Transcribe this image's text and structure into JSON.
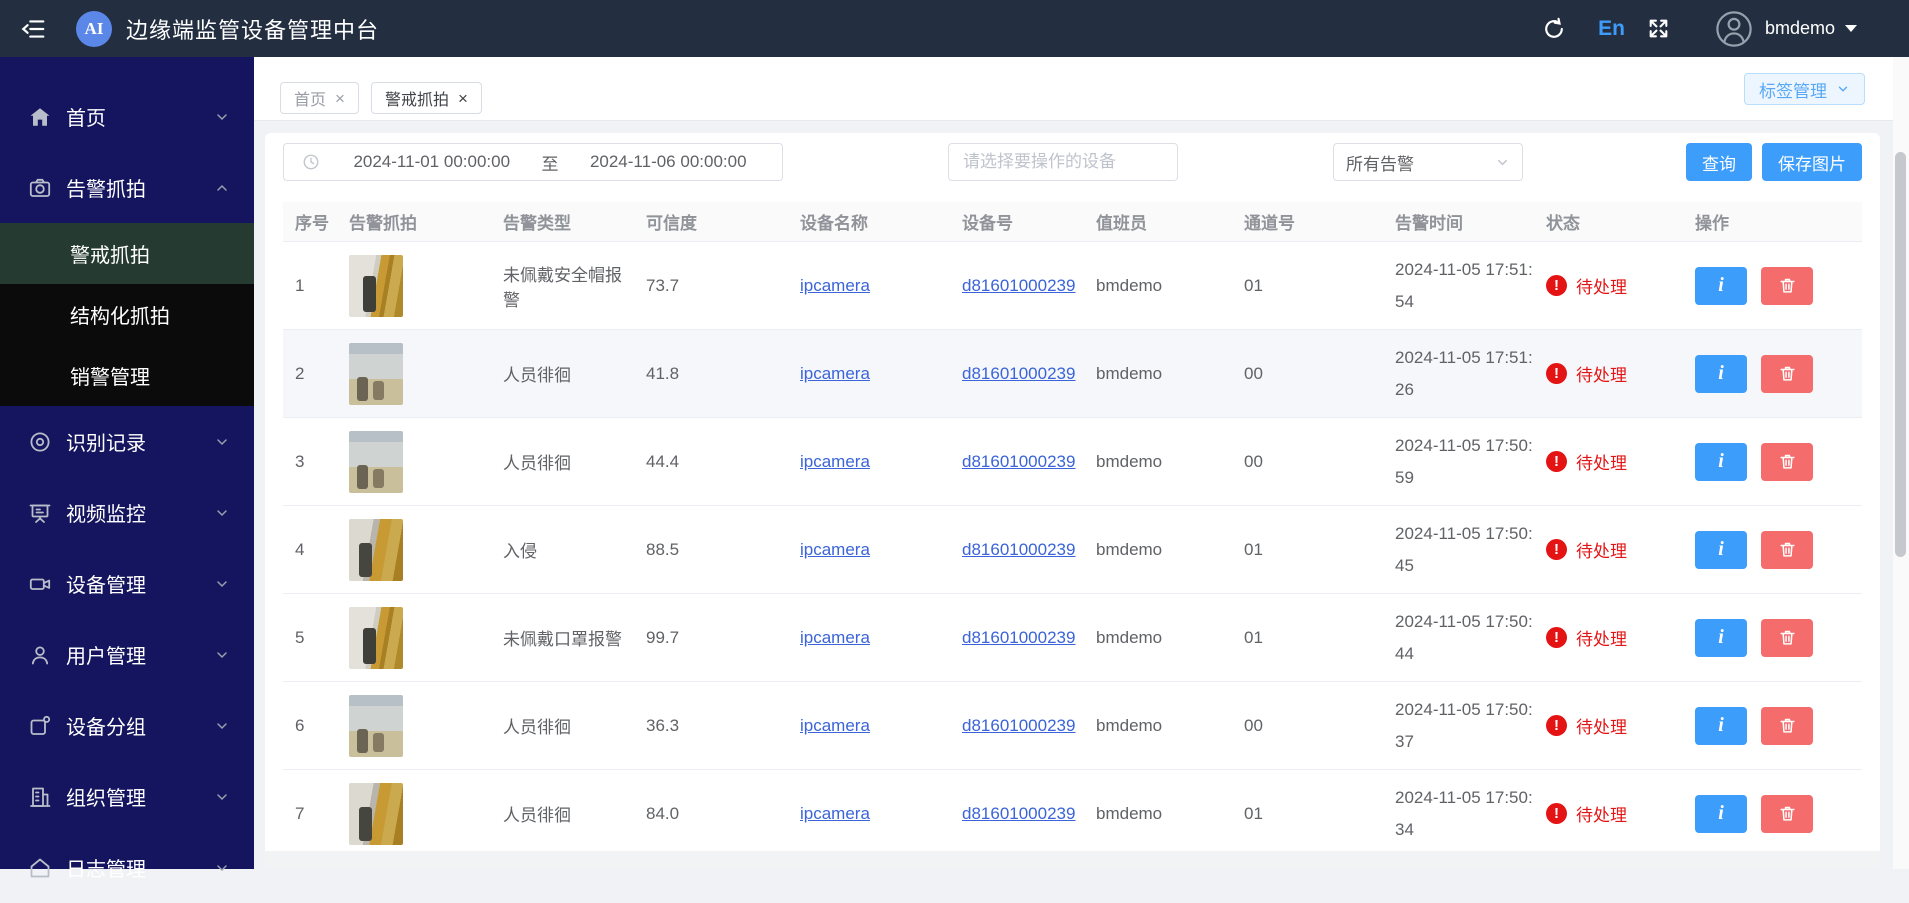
{
  "navbar": {
    "title": "边缘端监管设备管理中台",
    "logo": "AI",
    "language": "En",
    "username": "bmdemo"
  },
  "sidebar": {
    "menu": [
      {
        "label": "首页",
        "icon": "home-icon"
      },
      {
        "label": "告警抓拍",
        "icon": "camera-icon",
        "children": [
          {
            "label": "警戒抓拍",
            "active": true
          },
          {
            "label": "结构化抓拍",
            "active": false
          },
          {
            "label": "销警管理",
            "active": false
          }
        ]
      },
      {
        "label": "识别记录",
        "icon": "eye-icon"
      },
      {
        "label": "视频监控",
        "icon": "monitor-icon"
      },
      {
        "label": "设备管理",
        "icon": "video-camera-icon"
      },
      {
        "label": "用户管理",
        "icon": "user-icon"
      },
      {
        "label": "设备分组",
        "icon": "device-group-icon"
      },
      {
        "label": "组织管理",
        "icon": "organization-icon"
      },
      {
        "label": "日志管理",
        "icon": "log-icon"
      }
    ]
  },
  "tabs": [
    {
      "label": "首页",
      "close": "×",
      "active": false
    },
    {
      "label": "警戒抓拍",
      "close": "×",
      "active": true
    }
  ],
  "tag_manage": {
    "label": "标签管理"
  },
  "filters": {
    "date_start": "2024-11-01 00:00:00",
    "date_separator": "至",
    "date_end": "2024-11-06 00:00:00",
    "device_placeholder": "请选择要操作的设备",
    "alarm_type_selected": "所有告警",
    "query_button": "查询",
    "save_image_button": "保存图片"
  },
  "table": {
    "columns": [
      "序号",
      "告警抓拍",
      "告警类型",
      "可信度",
      "设备名称",
      "设备号",
      "值班员",
      "通道号",
      "告警时间",
      "状态",
      "操作"
    ],
    "rows": [
      {
        "index": "1",
        "type": "未佩戴安全帽报警",
        "confidence": "73.7",
        "device_name": "ipcamera",
        "device_id": "d81601000239",
        "operator": "bmdemo",
        "channel": "01",
        "time_line1": "2024-11-05 17:51:",
        "time_line2": "54",
        "status": "待处理",
        "state": "",
        "thumb": "thumb-a"
      },
      {
        "index": "2",
        "type": "人员徘徊",
        "confidence": "41.8",
        "device_name": "ipcamera",
        "device_id": "d81601000239",
        "operator": "bmdemo",
        "channel": "00",
        "time_line1": "2024-11-05 17:51:",
        "time_line2": "26",
        "status": "待处理",
        "state": "hover",
        "thumb": "thumb-b"
      },
      {
        "index": "3",
        "type": "人员徘徊",
        "confidence": "44.4",
        "device_name": "ipcamera",
        "device_id": "d81601000239",
        "operator": "bmdemo",
        "channel": "00",
        "time_line1": "2024-11-05 17:50:",
        "time_line2": "59",
        "status": "待处理",
        "state": "",
        "thumb": "thumb-b"
      },
      {
        "index": "4",
        "type": "入侵",
        "confidence": "88.5",
        "device_name": "ipcamera",
        "device_id": "d81601000239",
        "operator": "bmdemo",
        "channel": "01",
        "time_line1": "2024-11-05 17:50:",
        "time_line2": "45",
        "status": "待处理",
        "state": "",
        "thumb": "thumb-c"
      },
      {
        "index": "5",
        "type": "未佩戴口罩报警",
        "confidence": "99.7",
        "device_name": "ipcamera",
        "device_id": "d81601000239",
        "operator": "bmdemo",
        "channel": "01",
        "time_line1": "2024-11-05 17:50:",
        "time_line2": "44",
        "status": "待处理",
        "state": "",
        "thumb": "thumb-a"
      },
      {
        "index": "6",
        "type": "人员徘徊",
        "confidence": "36.3",
        "device_name": "ipcamera",
        "device_id": "d81601000239",
        "operator": "bmdemo",
        "channel": "00",
        "time_line1": "2024-11-05 17:50:",
        "time_line2": "37",
        "status": "待处理",
        "state": "",
        "thumb": "thumb-b"
      },
      {
        "index": "7",
        "type": "人员徘徊",
        "confidence": "84.0",
        "device_name": "ipcamera",
        "device_id": "d81601000239",
        "operator": "bmdemo",
        "channel": "01",
        "time_line1": "2024-11-05 17:50:",
        "time_line2": "34",
        "status": "待处理",
        "state": "",
        "thumb": "thumb-c"
      }
    ]
  },
  "colors": {
    "navbar_bg": "#232f40",
    "sidebar_bg": "#15155f",
    "sidebar_active_bg": "#253b31",
    "accent_blue": "#3d9dfb",
    "link_blue": "#3a64d8",
    "status_red": "#e41414",
    "delete_red": "#f56c6c",
    "tag_button_blue": "#58a8f7"
  }
}
